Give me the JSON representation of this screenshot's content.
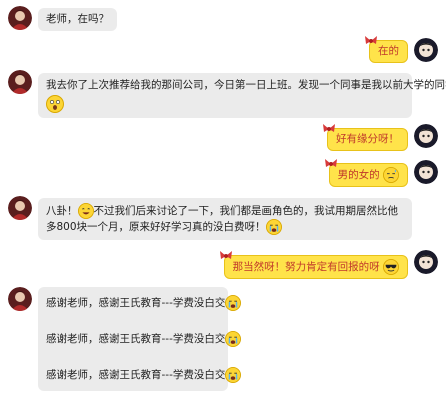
{
  "colors": {
    "left_bubble": "#ebebeb",
    "right_bubble": "#ffe34a",
    "right_text": "#c0392b"
  },
  "messages": [
    {
      "side": "left",
      "text": "老师，在吗？"
    },
    {
      "side": "right",
      "text": "在的"
    },
    {
      "side": "left",
      "text": "我去你了上次推荐给我的那间公司，今日第一日上班。发现一个同事是我以前大学的同学！",
      "emoji": "surprised-emoji"
    },
    {
      "side": "right",
      "text": "好有缘分呀！"
    },
    {
      "side": "right",
      "text": "男的女的",
      "emoji": "sweat-emoji"
    },
    {
      "side": "left",
      "text_a": "八卦！",
      "emoji_a": "grin-emoji",
      "text_b": "不过我们后来讨论了一下，我们都是画角色的，我试用期居然比他多800块一个月，原来好好学习真的没白费呀！",
      "emoji_b": "cry-emoji"
    },
    {
      "side": "right",
      "text": "那当然呀！努力肯定有回报的呀",
      "emoji": "cool-emoji"
    },
    {
      "side": "left",
      "lines": [
        "感谢老师，感谢王氏教育---学费没白交",
        "感谢老师，感谢王氏教育---学费没白交",
        "感谢老师，感谢王氏教育---学费没白交"
      ],
      "emoji": "cry-emoji"
    }
  ]
}
